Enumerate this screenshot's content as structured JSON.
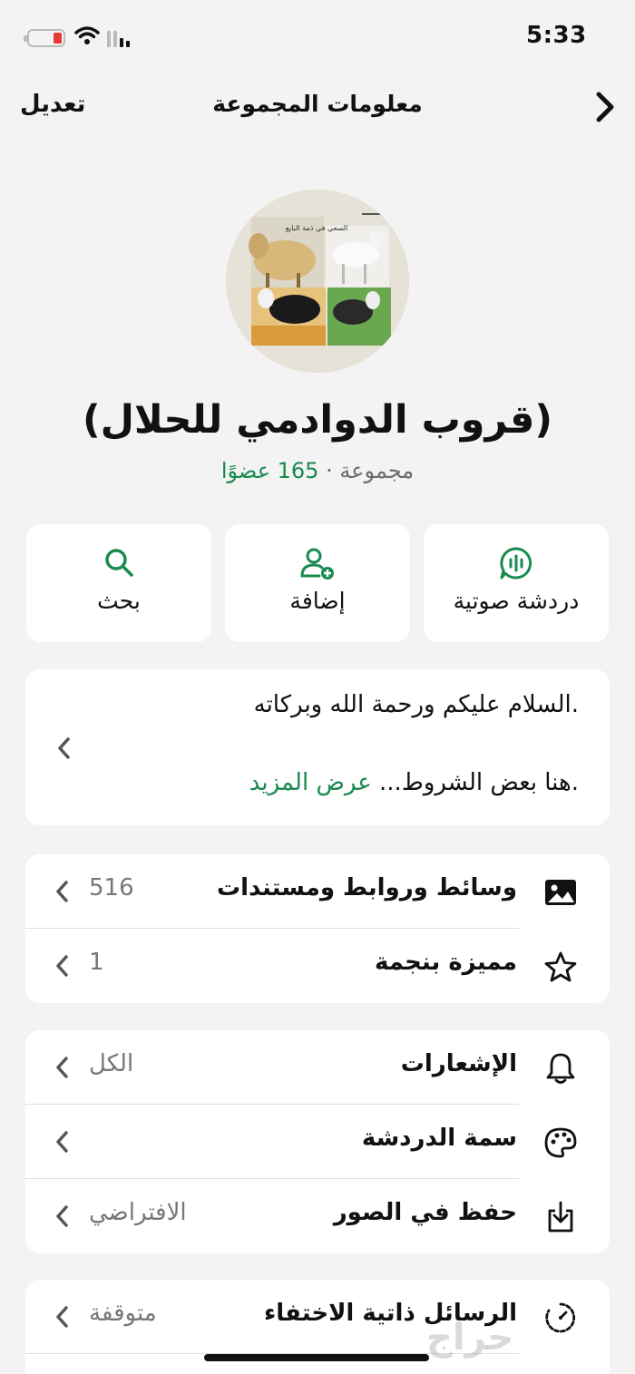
{
  "status": {
    "time": "5:33"
  },
  "nav": {
    "edit_label": "تعديل",
    "title": "معلومات المجموعة"
  },
  "avatar": {
    "caption": "السعي في ذمة البايع"
  },
  "group": {
    "name": "(قروب الدوادمي للحلال)",
    "type": "مجموعة ·",
    "members": "165 عضوًا"
  },
  "actions": [
    {
      "label": "دردشة صوتية",
      "icon": "voice-chat-icon"
    },
    {
      "label": "إضافة",
      "icon": "add-user-icon"
    },
    {
      "label": "بحث",
      "icon": "search-icon"
    }
  ],
  "description": {
    "line1": ".السلام عليكم ورحمة الله وبركاته",
    "line2": ".هنا بعض الشروط...",
    "more": "عرض المزيد"
  },
  "media_section": {
    "rows": [
      {
        "label": "وسائط وروابط ومستندات",
        "value": "516",
        "icon": "image-icon"
      },
      {
        "label": "مميزة بنجمة",
        "value": "1",
        "icon": "star-icon"
      }
    ]
  },
  "settings_section": {
    "rows": [
      {
        "label": "الإشعارات",
        "value": "الكل",
        "icon": "bell-icon"
      },
      {
        "label": "سمة الدردشة",
        "value": "",
        "icon": "palette-icon"
      },
      {
        "label": "حفظ في الصور",
        "value": "الافتراضي",
        "icon": "save-icon"
      }
    ]
  },
  "privacy_section": {
    "rows": [
      {
        "label": "الرسائل ذاتية الاختفاء",
        "value": "متوقفة",
        "icon": "timer-icon"
      }
    ]
  },
  "watermark": "حراج",
  "colors": {
    "accent": "#1a8a4f",
    "background": "#f3f3f3",
    "card": "#ffffff",
    "battery": "#e53935"
  }
}
